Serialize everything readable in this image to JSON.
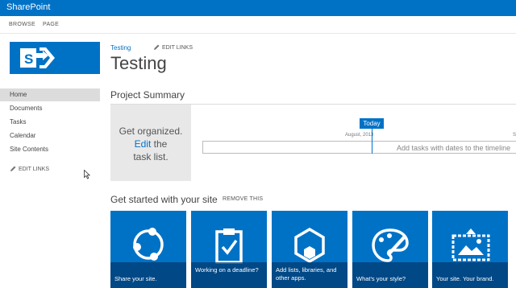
{
  "topbar": {
    "brand": "SharePoint"
  },
  "ribbon": {
    "tabs": [
      "BROWSE",
      "PAGE"
    ]
  },
  "header": {
    "breadcrumb": "Testing",
    "edit_links": "EDIT LINKS",
    "title": "Testing"
  },
  "nav": {
    "items": [
      "Home",
      "Documents",
      "Tasks",
      "Calendar",
      "Site Contents"
    ],
    "selected": "Home",
    "edit_links": "EDIT LINKS"
  },
  "project_summary": {
    "title": "Project Summary",
    "get_organized": {
      "line1": "Get organized.",
      "edit": "Edit",
      "the": " the",
      "line3": "task list."
    },
    "today_label": "Today",
    "month_label": "August, 2013",
    "right_mark": "S",
    "timeline_placeholder": "Add tasks with dates to the timeline"
  },
  "get_started": {
    "title": "Get started with your site",
    "remove_label": "REMOVE THIS",
    "tiles": [
      {
        "icon": "share-icon",
        "caption": "Share your site."
      },
      {
        "icon": "clipboard-check-icon",
        "caption": "Working on a deadline?"
      },
      {
        "icon": "hexagon-apps-icon",
        "caption": "Add lists, libraries, and other apps."
      },
      {
        "icon": "palette-icon",
        "caption": "What's your style?"
      },
      {
        "icon": "brand-picture-icon",
        "caption": "Your site. Your brand."
      }
    ]
  },
  "colors": {
    "accent": "#0072c6",
    "selected_nav": "#dcdcdc",
    "tile_caption": "#00376e"
  }
}
